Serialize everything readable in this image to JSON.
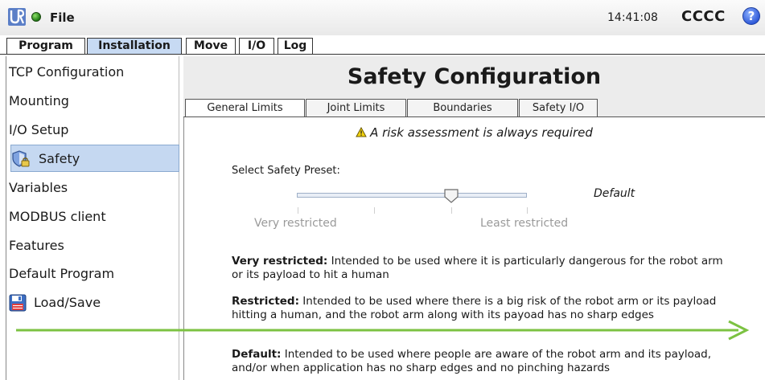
{
  "topbar": {
    "logo_icon": "ur-logo-icon",
    "status_icon": "robot-status-green-icon",
    "file_label": "File",
    "clock": "14:41:08",
    "robot_name": "CCCC",
    "help_label": "?"
  },
  "main_tabs": [
    {
      "label": "Program",
      "active": false
    },
    {
      "label": "Installation",
      "active": true
    },
    {
      "label": "Move",
      "active": false
    },
    {
      "label": "I/O",
      "active": false
    },
    {
      "label": "Log",
      "active": false
    }
  ],
  "sidebar": {
    "items": [
      {
        "label": "TCP Configuration"
      },
      {
        "label": "Mounting"
      },
      {
        "label": "I/O Setup"
      },
      {
        "label": "Safety",
        "icon": "shield-lock-icon",
        "selected": true
      },
      {
        "label": "Variables"
      },
      {
        "label": "MODBUS client"
      },
      {
        "label": "Features"
      },
      {
        "label": "Default Program"
      },
      {
        "label": "Load/Save",
        "icon": "floppy-disk-icon"
      }
    ]
  },
  "panel": {
    "title": "Safety Configuration",
    "subtabs": [
      {
        "label": "General Limits",
        "active": true
      },
      {
        "label": "Joint Limits",
        "active": false
      },
      {
        "label": "Boundaries",
        "active": false
      },
      {
        "label": "Safety I/O",
        "active": false
      }
    ],
    "risk_notice": "A risk assessment is always required",
    "preset": {
      "label": "Select Safety Preset:",
      "value": "Default",
      "min_label": "Very restricted",
      "max_label": "Least restricted",
      "position_fraction": 0.67
    },
    "descriptions": [
      {
        "term": "Very restricted:",
        "text": " Intended to be used where it is particularly dangerous for the robot arm or its payload to hit a human"
      },
      {
        "term": "Restricted:",
        "text": " Intended to be used where there is a big risk of the robot arm or its payload hitting a human, and the robot arm along with its payoad has no sharp edges"
      },
      {
        "term": "Default:",
        "text": " Intended to be used where people are aware of the robot arm and its payload, and/or when application has no sharp edges and no pinching hazards"
      }
    ]
  },
  "colors": {
    "active_tab": "#c7daf3",
    "selected_item": "#c5d8f1",
    "annotation_arrow": "#7cc242",
    "help_icon": "#2a55d6"
  }
}
